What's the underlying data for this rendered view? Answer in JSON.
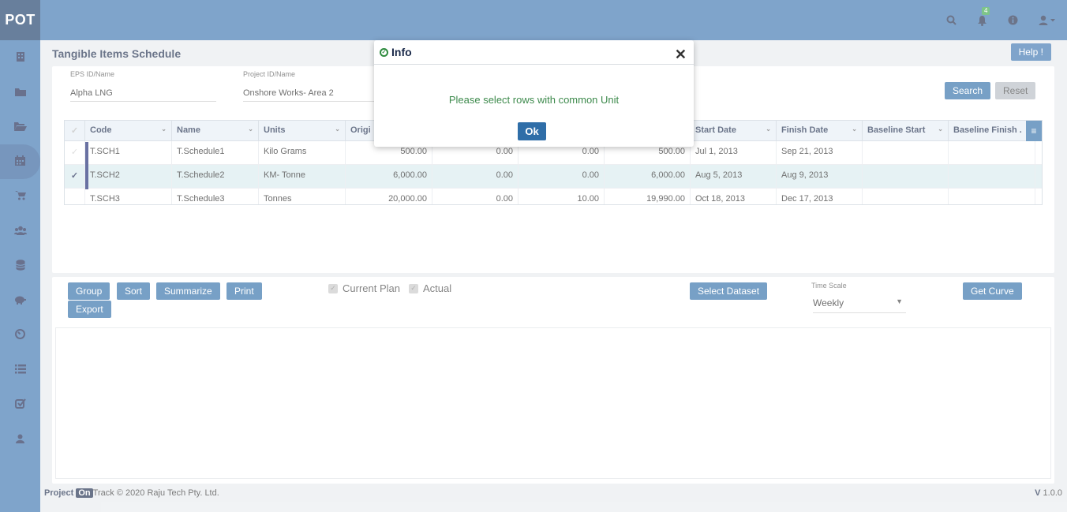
{
  "app": {
    "logo": "POT",
    "notification_count": "4"
  },
  "topbar": {
    "icons": [
      "search-icon",
      "bell-icon",
      "info-icon",
      "user-icon"
    ]
  },
  "sidebar": {
    "icons": [
      "building-icon",
      "folder-icon",
      "folder-open-icon",
      "calendar-icon",
      "cart-icon",
      "users-icon",
      "database-icon",
      "piggy-bank-icon",
      "dashboard-icon",
      "list-icon",
      "checklist-icon",
      "user-icon"
    ]
  },
  "page": {
    "title": "Tangible Items Schedule",
    "help_label": "Help !"
  },
  "filters": {
    "eps_label": "EPS ID/Name",
    "eps_value": "Alpha LNG",
    "project_label": "Project ID/Name",
    "project_value": "Onshore  Works- Area 2",
    "search_label": "Search",
    "reset_label": "Reset"
  },
  "grid": {
    "columns": [
      "Code",
      "Name",
      "Units",
      "Origi",
      "",
      "",
      "",
      "Start Date",
      "Finish Date",
      "Baseline Start",
      "Baseline Finish ."
    ],
    "rows": [
      {
        "code": "T.SCH1",
        "name": "T.Schedule1",
        "units": "Kilo Grams",
        "orig": "500.00",
        "a": "0.00",
        "b": "0.00",
        "c": "500.00",
        "start": "Jul 1, 2013",
        "finish": "Sep 21, 2013",
        "checked": false
      },
      {
        "code": "T.SCH2",
        "name": "T.Schedule2",
        "units": "KM- Tonne",
        "orig": "6,000.00",
        "a": "0.00",
        "b": "0.00",
        "c": "6,000.00",
        "start": "Aug 5, 2013",
        "finish": "Aug 9, 2013",
        "checked": true
      },
      {
        "code": "T.SCH3",
        "name": "T.Schedule3",
        "units": "Tonnes",
        "orig": "20,000.00",
        "a": "0.00",
        "b": "10.00",
        "c": "19,990.00",
        "start": "Oct 18, 2013",
        "finish": "Dec 17, 2013",
        "checked": false
      }
    ]
  },
  "toolbar": {
    "group_label": "Group",
    "sort_label": "Sort",
    "summarize_label": "Summarize",
    "print_label": "Print",
    "export_label": "Export",
    "current_plan_label": "Current Plan",
    "actual_label": "Actual",
    "select_dataset_label": "Select Dataset",
    "time_scale_label": "Time Scale",
    "time_scale_value": "Weekly",
    "get_curve_label": "Get Curve"
  },
  "footer": {
    "brand_project": "Project",
    "brand_on": "On",
    "brand_rest": "Track © 2020 Raju Tech Pty. Ltd.",
    "version_v": "V",
    "version_num": "1.0.0"
  },
  "modal": {
    "title": "Info",
    "message": "Please select rows with common Unit",
    "ok_label": "Ok"
  }
}
